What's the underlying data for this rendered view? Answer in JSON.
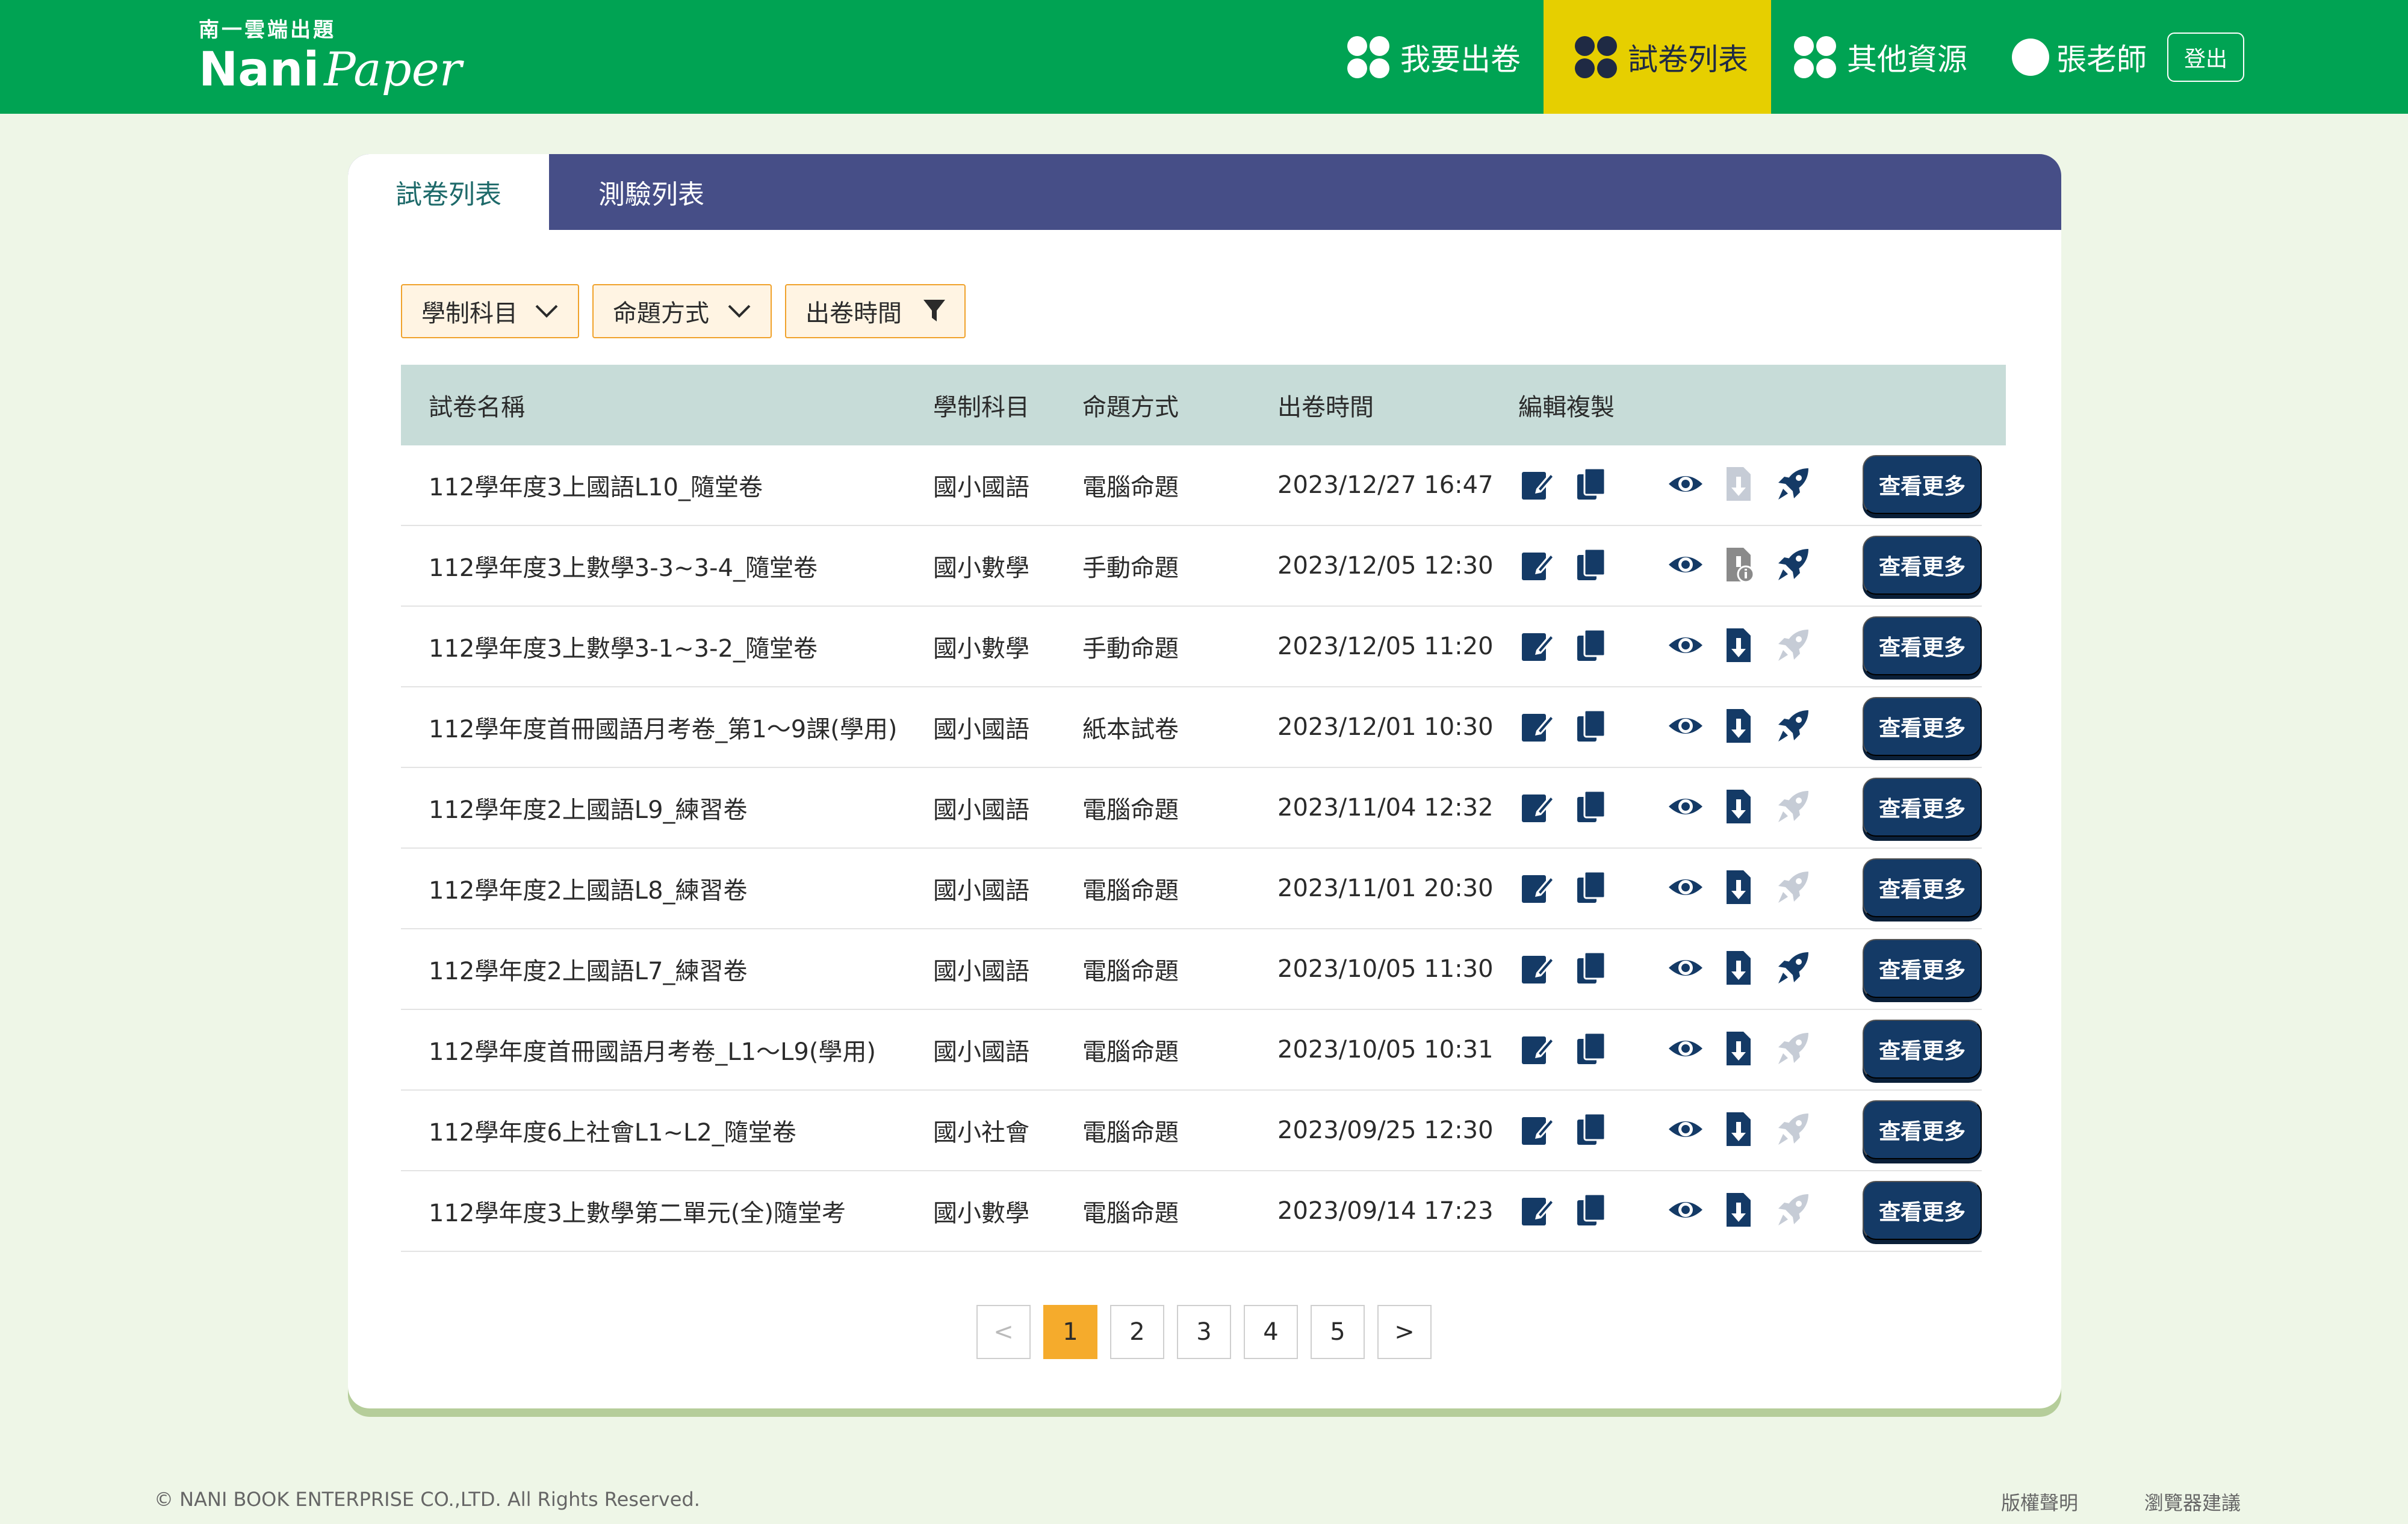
{
  "brand": {
    "subtitle": "南一雲端出題",
    "name_part1": "Nani",
    "name_part2": "Paper"
  },
  "nav": {
    "items": [
      {
        "label": "我要出卷",
        "active": false
      },
      {
        "label": "試卷列表",
        "active": true
      },
      {
        "label": "其他資源",
        "active": false
      }
    ],
    "user_name": "張老師",
    "logout_label": "登出"
  },
  "tabs": [
    {
      "label": "試卷列表",
      "active": true
    },
    {
      "label": "測驗列表",
      "active": false
    }
  ],
  "filters": [
    {
      "label": "學制科目",
      "icon": "chevron-down-icon"
    },
    {
      "label": "命題方式",
      "icon": "chevron-down-icon"
    },
    {
      "label": "出卷時間",
      "icon": "filter-icon"
    }
  ],
  "table": {
    "columns": [
      "試卷名稱",
      "學制科目",
      "命題方式",
      "出卷時間",
      "編輯複製"
    ],
    "more_label": "查看更多",
    "rows": [
      {
        "name": "112學年度3上國語L10_隨堂卷",
        "subject": "國小國語",
        "mode": "電腦命題",
        "time": "2023/12/27 16:47",
        "download": "disabled",
        "rocket": "active"
      },
      {
        "name": "112學年度3上數學3-3~3-4_隨堂卷",
        "subject": "國小數學",
        "mode": "手動命題",
        "time": "2023/12/05 12:30",
        "download": "info",
        "rocket": "active"
      },
      {
        "name": "112學年度3上數學3-1~3-2_隨堂卷",
        "subject": "國小數學",
        "mode": "手動命題",
        "time": "2023/12/05 11:20",
        "download": "active",
        "rocket": "disabled"
      },
      {
        "name": "112學年度首冊國語月考卷_第1～9課(學用)",
        "subject": "國小國語",
        "mode": "紙本試卷",
        "time": "2023/12/01 10:30",
        "download": "active",
        "rocket": "active"
      },
      {
        "name": "112學年度2上國語L9_練習卷",
        "subject": "國小國語",
        "mode": "電腦命題",
        "time": "2023/11/04 12:32",
        "download": "active",
        "rocket": "disabled"
      },
      {
        "name": "112學年度2上國語L8_練習卷",
        "subject": "國小國語",
        "mode": "電腦命題",
        "time": "2023/11/01 20:30",
        "download": "active",
        "rocket": "disabled"
      },
      {
        "name": "112學年度2上國語L7_練習卷",
        "subject": "國小國語",
        "mode": "電腦命題",
        "time": "2023/10/05 11:30",
        "download": "active",
        "rocket": "active"
      },
      {
        "name": "112學年度首冊國語月考卷_L1～L9(學用)",
        "subject": "國小國語",
        "mode": "電腦命題",
        "time": "2023/10/05 10:31",
        "download": "active",
        "rocket": "disabled"
      },
      {
        "name": "112學年度6上社會L1~L2_隨堂卷",
        "subject": "國小社會",
        "mode": "電腦命題",
        "time": "2023/09/25 12:30",
        "download": "active",
        "rocket": "disabled"
      },
      {
        "name": "112學年度3上數學第二單元(全)隨堂考",
        "subject": "國小數學",
        "mode": "電腦命題",
        "time": "2023/09/14 17:23",
        "download": "active",
        "rocket": "disabled"
      }
    ]
  },
  "pagination": {
    "prev": "<",
    "next": ">",
    "pages": [
      "1",
      "2",
      "3",
      "4",
      "5"
    ],
    "current": "1"
  },
  "footer": {
    "copyright": "© NANI BOOK ENTERPRISE CO.,LTD. All Rights Reserved.",
    "links": [
      "版權聲明",
      "瀏覽器建議"
    ]
  },
  "colors": {
    "header_green": "#00a353",
    "nav_active": "#e6cf00",
    "tab_bar": "#464e87",
    "button_navy": "#143a66",
    "filter_orange": "#f0a22b",
    "page_active": "#f5ab2c"
  }
}
